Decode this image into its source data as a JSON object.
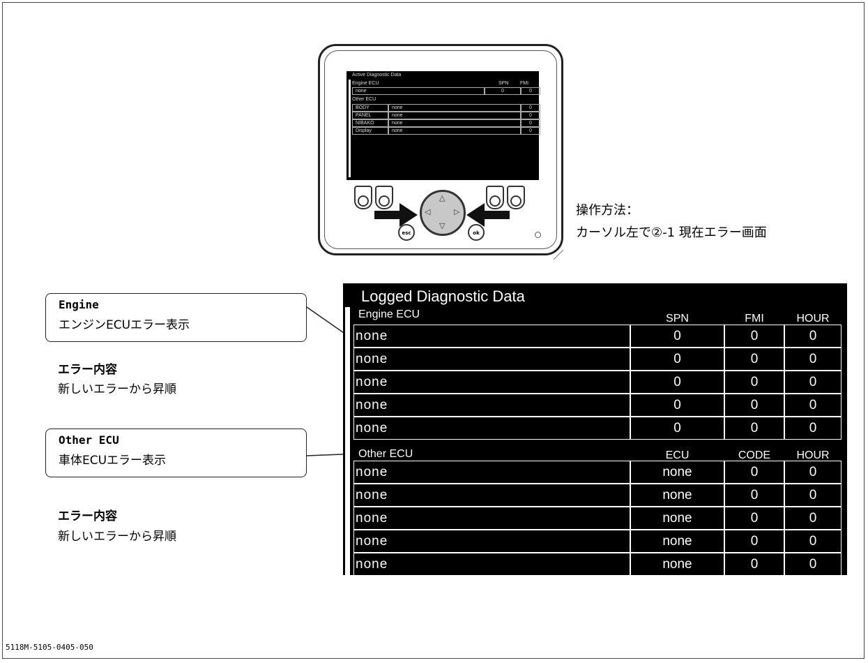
{
  "device": {
    "mini_screen": {
      "title": "Active Diagnostic Data",
      "engine_label": "Engine ECU",
      "spn_header": "SPN",
      "fmi_header": "FMI",
      "engine_row": {
        "name": "none",
        "spn": "0",
        "fmi": "0"
      },
      "other_label": "Other ECU",
      "other_rows": [
        {
          "label": "BODY",
          "value": "none",
          "count": "0"
        },
        {
          "label": "PANEL",
          "value": "none",
          "count": "0"
        },
        {
          "label": "NIBAKO",
          "value": "none",
          "count": "0"
        },
        {
          "label": "Display",
          "value": "none",
          "count": "0"
        }
      ]
    },
    "esc_label": "esc",
    "ok_label": "ok"
  },
  "operation": {
    "line1": "操作方法：",
    "line2": "カーソル左で②-1 現在エラー画面"
  },
  "callouts": [
    {
      "title": "Engine",
      "text": "エンジンECUエラー表示"
    },
    {
      "title": "Other ECU",
      "text": "車体ECUエラー表示"
    }
  ],
  "notes": [
    {
      "heading": "エラー内容",
      "body": "新しいエラーから昇順"
    },
    {
      "heading": "エラー内容",
      "body": "新しいエラーから昇順"
    }
  ],
  "logged": {
    "title": "Logged Diagnostic Data",
    "engine_section": "Engine ECU",
    "engine_headers": [
      "SPN",
      "FMI",
      "HOUR"
    ],
    "engine_rows": [
      [
        "none",
        "0",
        "0",
        "0"
      ],
      [
        "none",
        "0",
        "0",
        "0"
      ],
      [
        "none",
        "0",
        "0",
        "0"
      ],
      [
        "none",
        "0",
        "0",
        "0"
      ],
      [
        "none",
        "0",
        "0",
        "0"
      ]
    ],
    "other_section": "Other ECU",
    "other_headers": [
      "ECU",
      "CODE",
      "HOUR"
    ],
    "other_rows": [
      [
        "none",
        "none",
        "0",
        "0"
      ],
      [
        "none",
        "none",
        "0",
        "0"
      ],
      [
        "none",
        "none",
        "0",
        "0"
      ],
      [
        "none",
        "none",
        "0",
        "0"
      ],
      [
        "none",
        "none",
        "0",
        "0"
      ]
    ]
  },
  "footer": "5118M-5105-0405-050"
}
